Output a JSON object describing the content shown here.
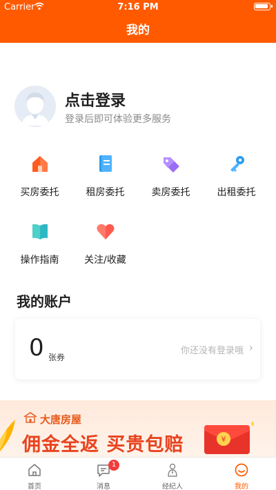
{
  "status_bar": {
    "carrier": "Carrier",
    "time": "7:16 PM"
  },
  "navbar": {
    "title": "我的"
  },
  "profile": {
    "login_title": "点击登录",
    "login_subtitle": "登录后即可体验更多服务"
  },
  "services": [
    {
      "label": "买房委托",
      "icon": "house-icon"
    },
    {
      "label": "租房委托",
      "icon": "document-icon"
    },
    {
      "label": "卖房委托",
      "icon": "tag-icon"
    },
    {
      "label": "出租委托",
      "icon": "key-icon"
    },
    {
      "label": "操作指南",
      "icon": "book-icon"
    },
    {
      "label": "关注/收藏",
      "icon": "heart-icon"
    }
  ],
  "account": {
    "title": "我的账户",
    "coupon_count": "0",
    "coupon_unit": "张券",
    "login_hint": "你还没有登录哦"
  },
  "banner": {
    "brand": "大唐房屋",
    "slogan": "佣金全返 买贵包赔"
  },
  "tabbar": {
    "items": [
      {
        "label": "首页",
        "icon": "home-icon"
      },
      {
        "label": "消息",
        "icon": "message-icon",
        "badge": "1"
      },
      {
        "label": "经纪人",
        "icon": "agent-icon"
      },
      {
        "label": "我的",
        "icon": "smile-icon",
        "active": true
      }
    ]
  },
  "colors": {
    "brand": "#ff5a00",
    "badge": "#f23c3c",
    "slogan": "#e8431f"
  }
}
